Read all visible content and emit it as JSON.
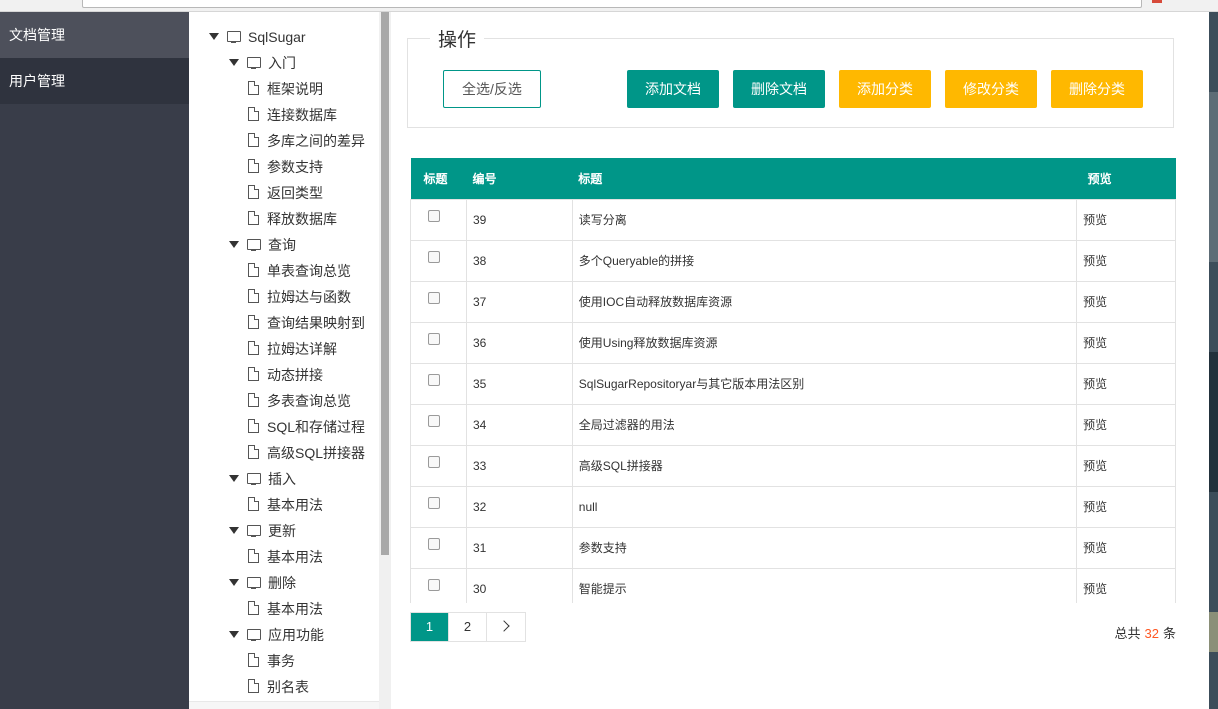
{
  "nav": {
    "items": [
      {
        "label": "文档管理"
      },
      {
        "label": "用户管理"
      }
    ]
  },
  "tree": {
    "root": "SqlSugar",
    "folders": [
      {
        "label": "入门",
        "children": [
          "框架说明",
          "连接数据库",
          "多库之间的差异",
          "参数支持",
          "返回类型",
          "释放数据库"
        ]
      },
      {
        "label": "查询",
        "children": [
          "单表查询总览",
          "拉姆达与函数",
          "查询结果映射到",
          "拉姆达详解",
          "动态拼接",
          "多表查询总览",
          "SQL和存储过程",
          "高级SQL拼接器"
        ]
      },
      {
        "label": "插入",
        "children": [
          "基本用法"
        ]
      },
      {
        "label": "更新",
        "children": [
          "基本用法"
        ]
      },
      {
        "label": "删除",
        "children": [
          "基本用法"
        ]
      },
      {
        "label": "应用功能",
        "children": [
          "事务",
          "别名表"
        ]
      }
    ]
  },
  "ops": {
    "legend": "操作",
    "select_toggle": "全选/反选",
    "add_doc": "添加文档",
    "delete_doc": "删除文档",
    "add_category": "添加分类",
    "edit_category": "修改分类",
    "delete_category": "删除分类"
  },
  "table": {
    "headers": [
      "标题",
      "编号",
      "标题",
      "预览"
    ],
    "rows": [
      {
        "id": "39",
        "title": "读写分离",
        "preview": "预览"
      },
      {
        "id": "38",
        "title": "多个Queryable的拼接",
        "preview": "预览"
      },
      {
        "id": "37",
        "title": "使用IOC自动释放数据库资源",
        "preview": "预览"
      },
      {
        "id": "36",
        "title": "使用Using释放数据库资源",
        "preview": "预览"
      },
      {
        "id": "35",
        "title": "SqlSugarRepositoryar与其它版本用法区别",
        "preview": "预览"
      },
      {
        "id": "34",
        "title": "全局过滤器的用法",
        "preview": "预览"
      },
      {
        "id": "33",
        "title": "高级SQL拼接器",
        "preview": "预览"
      },
      {
        "id": "32",
        "title": "null",
        "preview": "预览"
      },
      {
        "id": "31",
        "title": "参数支持",
        "preview": "预览"
      },
      {
        "id": "30",
        "title": "智能提示",
        "preview": "预览"
      }
    ]
  },
  "pager": {
    "pages": [
      "1",
      "2"
    ],
    "current": "1",
    "total_prefix": "总共",
    "total": "32",
    "total_suffix": "条"
  },
  "colors": {
    "primary": "#009688",
    "warm": "#ffb800",
    "nav_bg": "#393d49",
    "total_number": "#ff5722"
  }
}
